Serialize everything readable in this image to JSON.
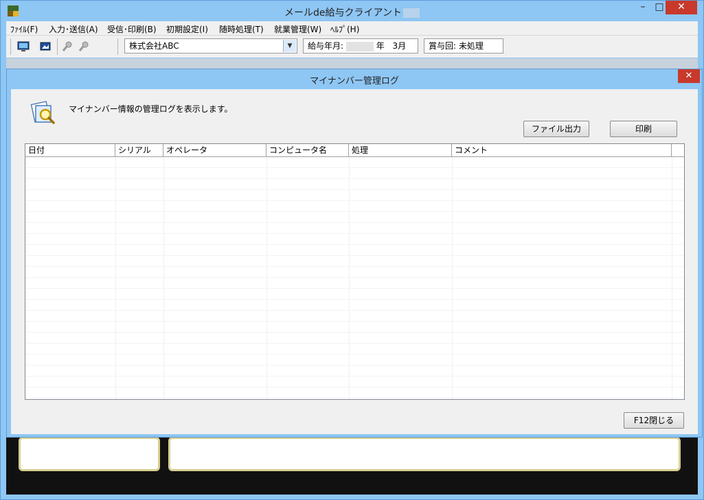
{
  "window": {
    "title": "メールde給与クライアント"
  },
  "menu": [
    "ﾌｧｲﾙ(F)",
    "入力･送信(A)",
    "受信･印刷(B)",
    "初期設定(I)",
    "随時処理(T)",
    "就業管理(W)",
    "ﾍﾙﾌﾟ(H)"
  ],
  "toolbar": {
    "company": "株式会社ABC",
    "pay_month_label": "給与年月:",
    "pay_month_year_suffix": "年",
    "pay_month_month": "3月",
    "bonus_label": "賞与回: 未処理"
  },
  "dialog": {
    "title": "マイナンバー管理ログ",
    "description": "マイナンバー情報の管理ログを表示します。",
    "file_output_button": "ファイル出力",
    "print_button": "印刷",
    "close_button": "F12閉じる",
    "columns": [
      "日付",
      "シリアル",
      "オペレータ",
      "コンピュータ名",
      "処理",
      "コメント"
    ]
  }
}
